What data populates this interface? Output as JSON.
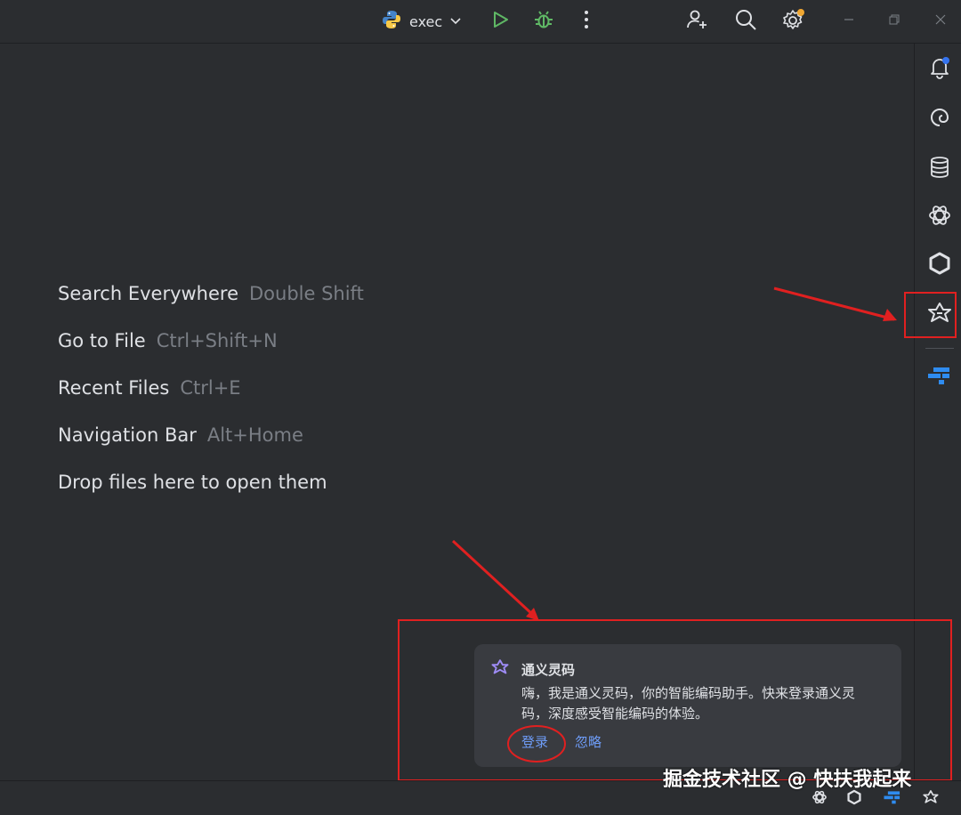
{
  "toolbar": {
    "run_config_label": "exec"
  },
  "welcome": {
    "hints": [
      {
        "action": "Search Everywhere",
        "shortcut": "Double Shift"
      },
      {
        "action": "Go to File",
        "shortcut": "Ctrl+Shift+N"
      },
      {
        "action": "Recent Files",
        "shortcut": "Ctrl+E"
      },
      {
        "action": "Navigation Bar",
        "shortcut": "Alt+Home"
      },
      {
        "action": "Drop files here to open them",
        "shortcut": ""
      }
    ]
  },
  "notification": {
    "title": "通义灵码",
    "body": "嗨，我是通义灵码，你的智能编码助手。快来登录通义灵码，深度感受智能编码的体验。",
    "login_label": "登录",
    "ignore_label": "忽略"
  },
  "watermark": {
    "text": "掘金技术社区 @ 快扶我起来"
  },
  "colors": {
    "accent_link": "#6e9cf7",
    "run_green": "#5fb865",
    "annotation_red": "#e02020",
    "notification_dot": "#3574f0",
    "settings_badge": "#f0a732"
  },
  "icons": {
    "run_config": "python-icon",
    "toolbar": [
      "run-icon",
      "debug-icon",
      "more-vertical-icon",
      "add-user-icon",
      "search-icon",
      "settings-icon"
    ],
    "right_strip": [
      "notifications-icon",
      "ai-spiral-icon",
      "database-icon",
      "chatgpt-icon",
      "hexagon-plugin-icon",
      "tongyi-lingma-icon",
      "codegeex-icon"
    ]
  }
}
